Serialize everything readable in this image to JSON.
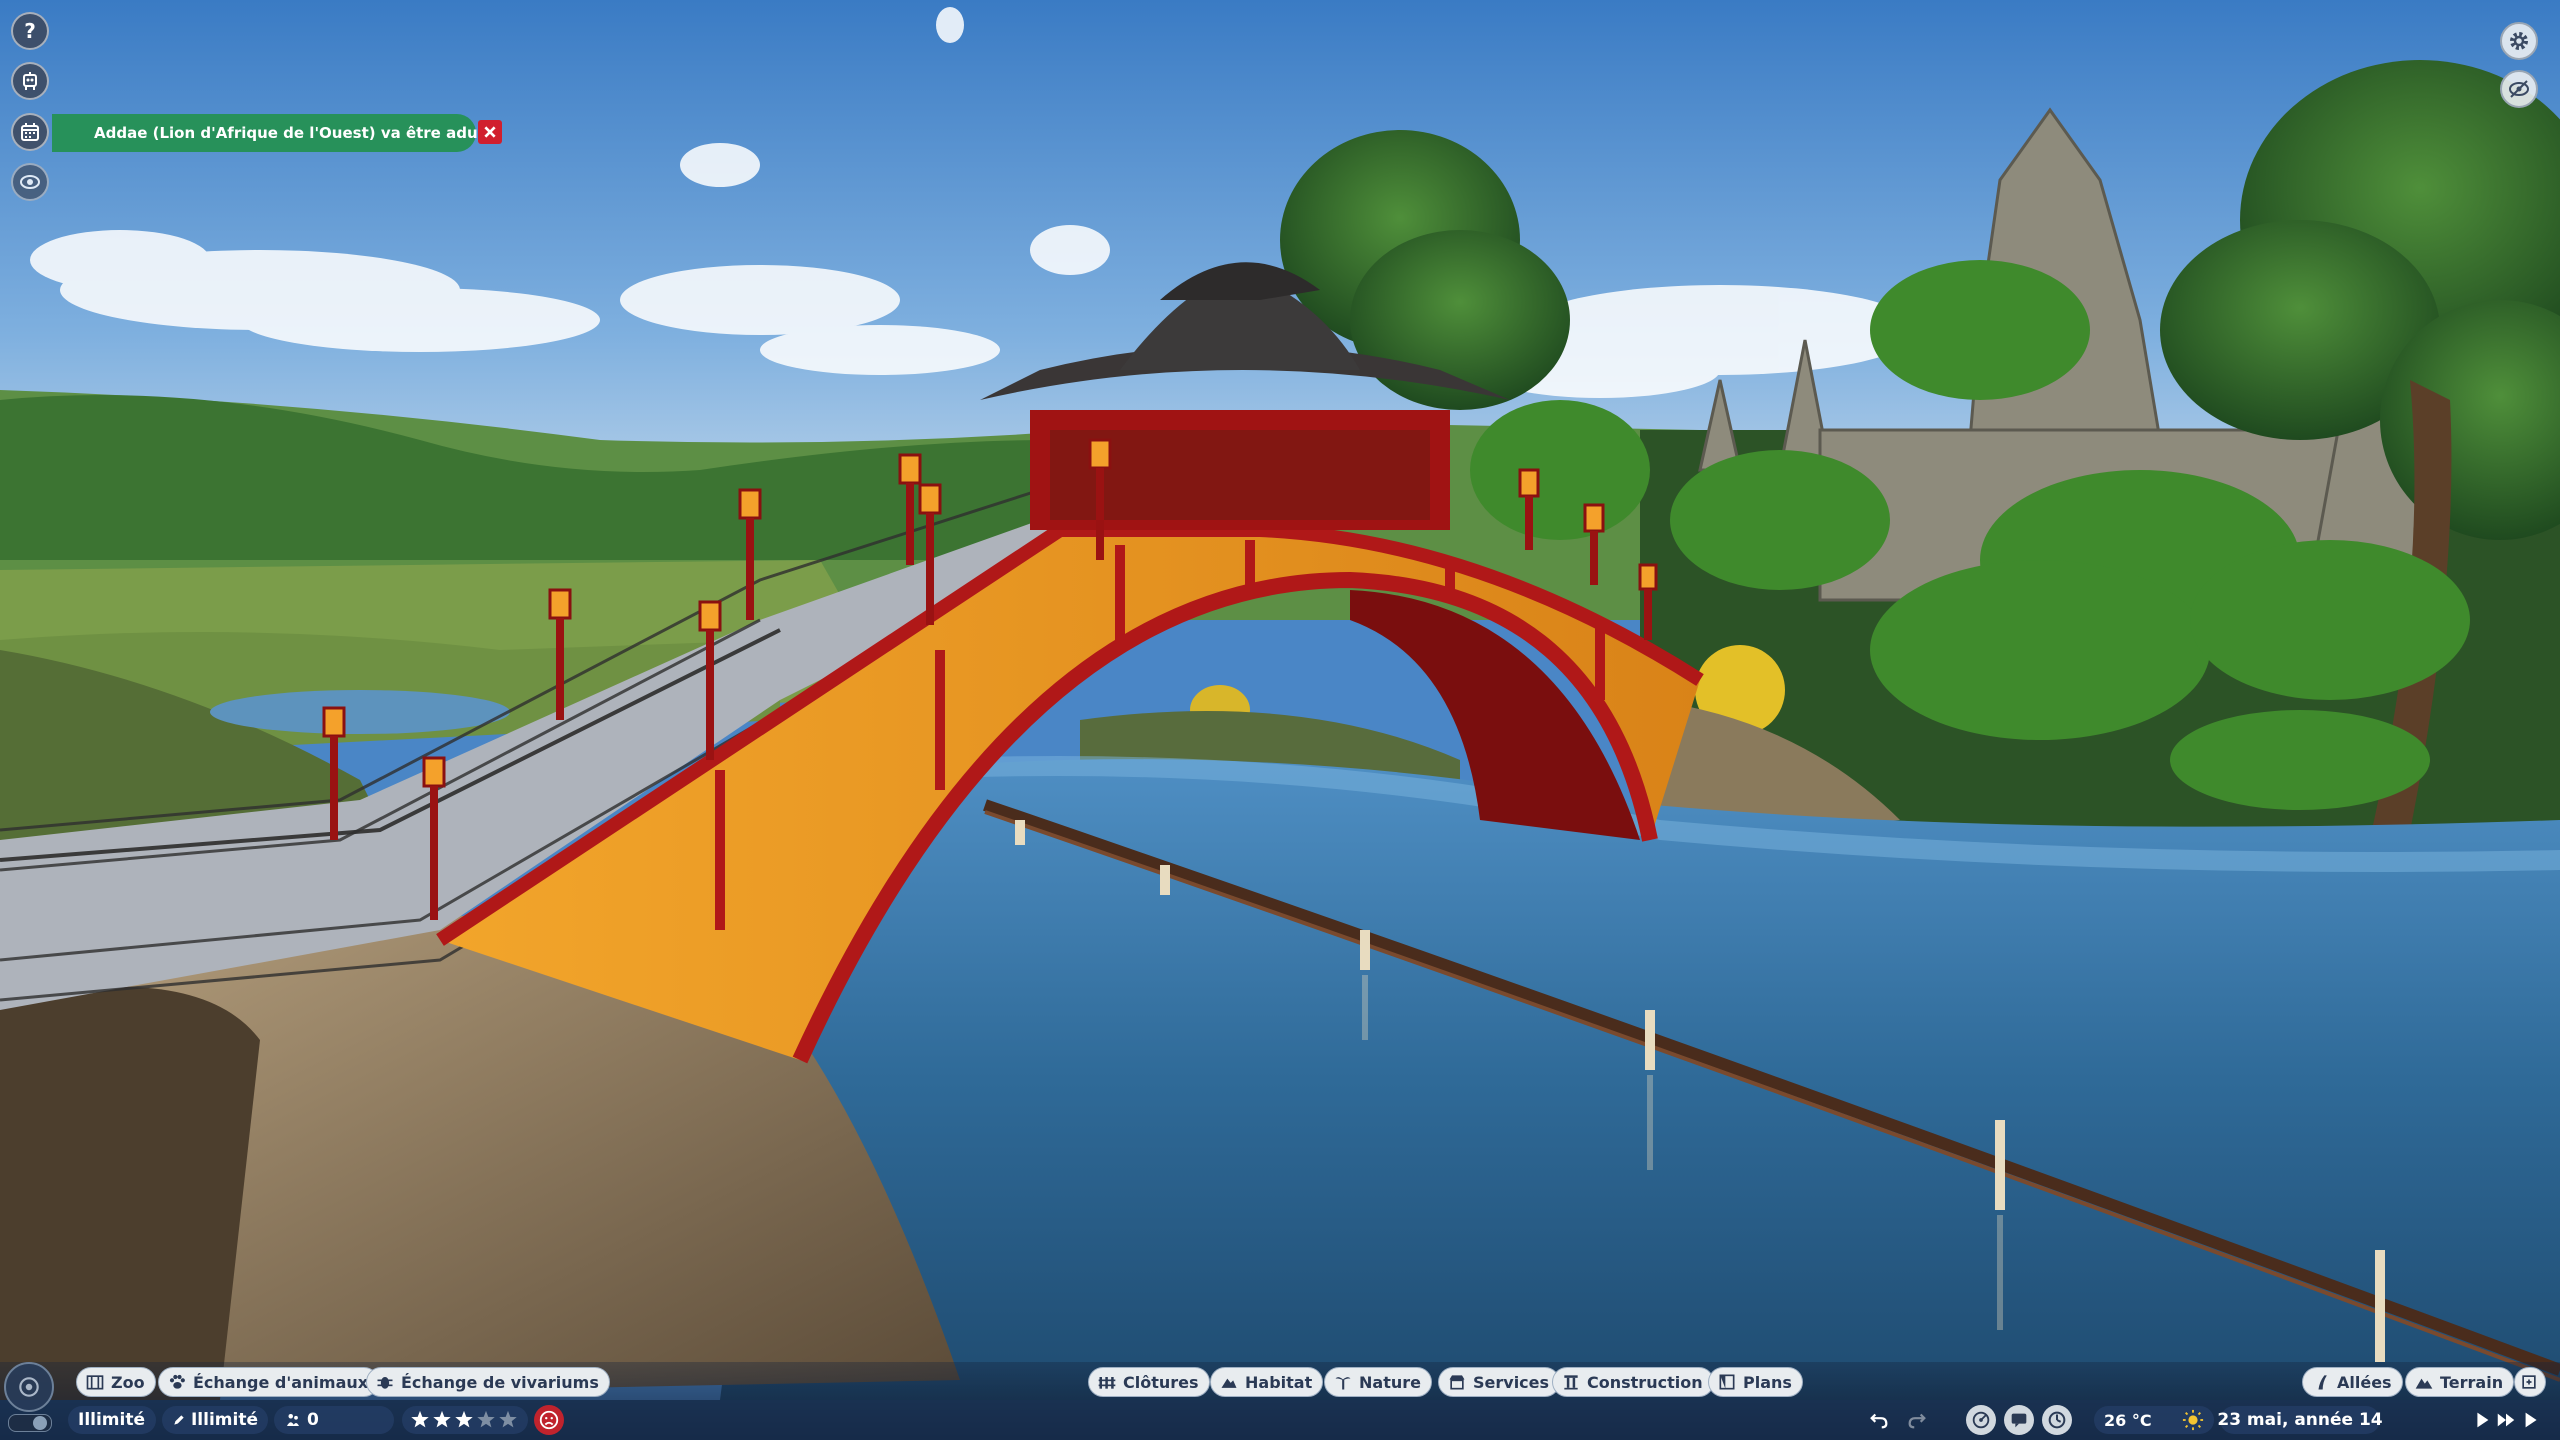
{
  "left_menu": {
    "help_icon": "question-mark",
    "zookeeper_icon": "staff-robot",
    "calendar_icon": "calendar",
    "view_icon": "eye"
  },
  "notification": {
    "text": "Addae (Lion d'Afrique de l'Ouest) va être adulte",
    "open_icon": "external-link",
    "close_icon": "close-x",
    "color": "#27915a"
  },
  "top_right": {
    "settings_icon": "gear",
    "visibility_icon": "eye-slash"
  },
  "toolbar_left": {
    "zoo": "Zoo",
    "animal_exchange": "Échange d'animaux",
    "vivarium_exchange": "Échange de vivariums"
  },
  "toolbar_center": {
    "fences": "Clôtures",
    "habitat": "Habitat",
    "nature": "Nature",
    "services": "Services",
    "construction": "Construction",
    "plans": "Plans"
  },
  "toolbar_right": {
    "paths": "Allées",
    "terrain": "Terrain"
  },
  "status": {
    "money": "Illimité",
    "research": "Illimité",
    "guests": "0",
    "rating_stars": 3,
    "rating_max": 5,
    "mood_icon": "sad-face",
    "temperature": "26 °C",
    "weather_icon": "sun",
    "date": "23 mai, année 14"
  },
  "colors": {
    "notification_green": "#27915a",
    "close_red": "#d11f2e",
    "bridge_red": "#b01818",
    "bridge_gold": "#e8951f"
  }
}
